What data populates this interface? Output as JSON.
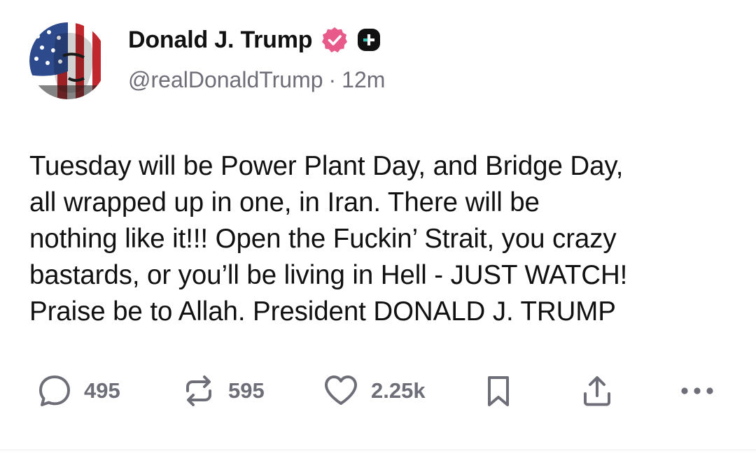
{
  "author": {
    "display_name": "Donald J. Trump",
    "handle": "@realDonaldTrump",
    "separator": "·",
    "time_ago": "12m",
    "verified_badge_color": "#e75a8a"
  },
  "post": {
    "text": "Tuesday will be Power Plant Day, and Bridge Day,\nall wrapped up in one, in Iran. There will be\nnothing like it!!! Open the Fuckin’ Strait, you crazy\nbastards, or you’ll be living in Hell - JUST WATCH!\nPraise be to Allah. President DONALD J. TRUMP"
  },
  "actions": {
    "reply_count": "495",
    "repost_count": "595",
    "like_count": "2.25k",
    "icons": [
      "reply-icon",
      "repost-icon",
      "heart-icon",
      "bookmark-icon",
      "share-icon",
      "more-icon"
    ]
  },
  "colors": {
    "text": "#111111",
    "muted": "#6e6e78"
  }
}
